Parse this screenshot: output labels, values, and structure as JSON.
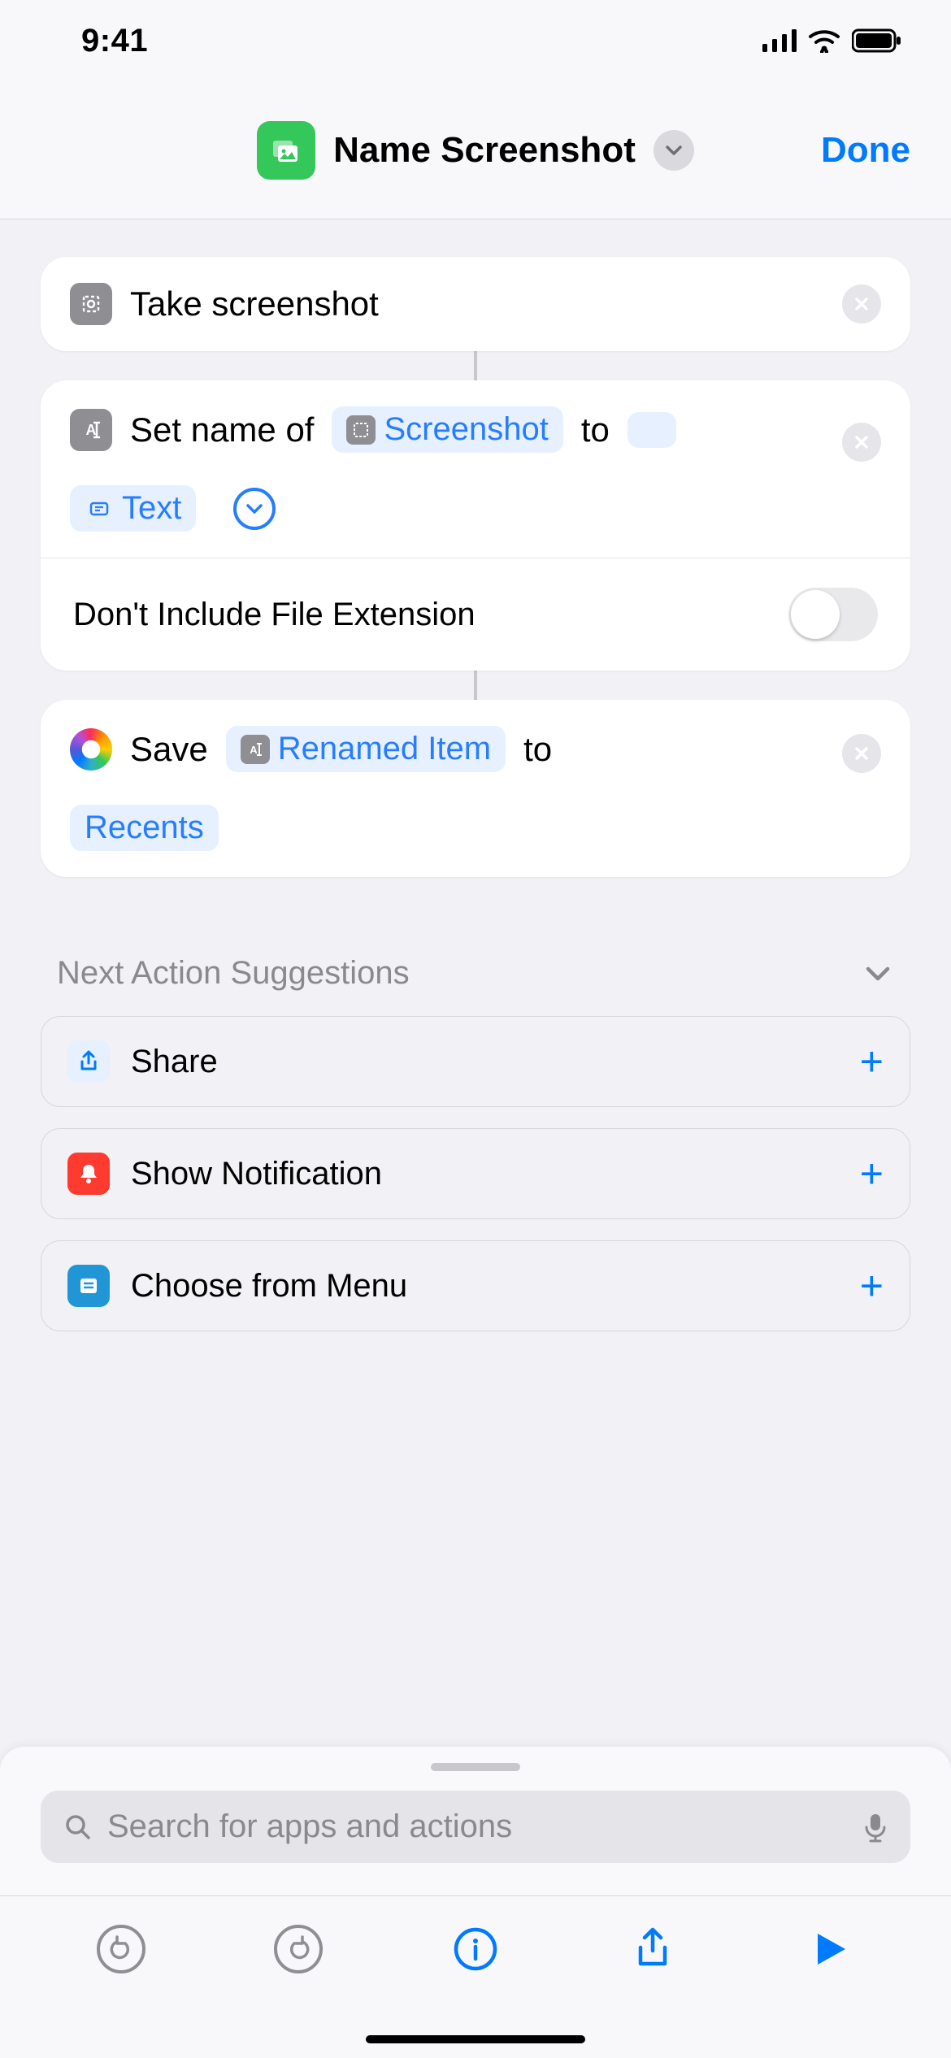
{
  "status": {
    "time": "9:41"
  },
  "header": {
    "title": "Name Screenshot",
    "done_label": "Done"
  },
  "actions": {
    "a1": {
      "title": "Take screenshot"
    },
    "a2": {
      "prefix": "Set name of",
      "var1": "Screenshot",
      "mid": "to",
      "text_token": "Text",
      "option_label": "Don't Include File Extension"
    },
    "a3": {
      "prefix": "Save",
      "var1": "Renamed Item",
      "mid": "to",
      "dest": "Recents"
    }
  },
  "suggestions": {
    "heading": "Next Action Suggestions",
    "items": {
      "share": "Share",
      "notification": "Show Notification",
      "menu": "Choose from Menu"
    }
  },
  "search": {
    "placeholder": "Search for apps and actions"
  }
}
